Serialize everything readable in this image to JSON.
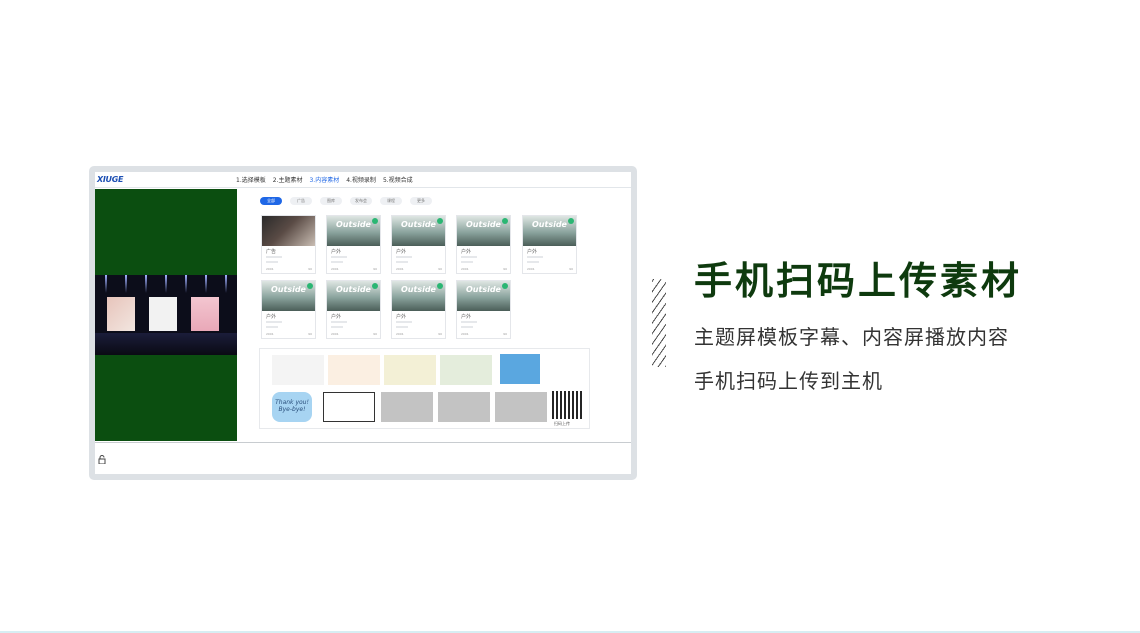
{
  "app": {
    "logo": "XIUGE",
    "steps": [
      {
        "label": "1.选择模板",
        "active": false
      },
      {
        "label": "2.主题素材",
        "active": false
      },
      {
        "label": "3.内容素材",
        "active": true
      },
      {
        "label": "4.视频录制",
        "active": false
      },
      {
        "label": "5.视频合成",
        "active": false
      }
    ],
    "filters": [
      "全部",
      "广告",
      "图库",
      "发布会",
      "课程",
      "更多"
    ],
    "cards": [
      {
        "name": "广告",
        "meta": "2001",
        "views": "90"
      },
      {
        "name": "户外",
        "meta": "2001",
        "views": "90"
      },
      {
        "name": "户外",
        "meta": "2001",
        "views": "90"
      },
      {
        "name": "户外",
        "meta": "2001",
        "views": "90"
      },
      {
        "name": "户外",
        "meta": "2001",
        "views": "90"
      },
      {
        "name": "户外",
        "meta": "2001",
        "views": "90"
      },
      {
        "name": "户外",
        "meta": "2001",
        "views": "90"
      },
      {
        "name": "户外",
        "meta": "2001",
        "views": "90"
      },
      {
        "name": "户外",
        "meta": "2001",
        "views": "90"
      }
    ],
    "card_title": "Outside",
    "upload": {
      "thanks_text": "Thank you! Bye-bye!",
      "qr_caption": "扫码上传"
    }
  },
  "headline": "手机扫码上传素材",
  "description": [
    "主题屏模板字幕、内容屏播放内容",
    "手机扫码上传到主机"
  ],
  "colors": {
    "accent": "#1f67e6",
    "headline": "#0e3a0e",
    "preview_bg": "#0b4e10"
  }
}
